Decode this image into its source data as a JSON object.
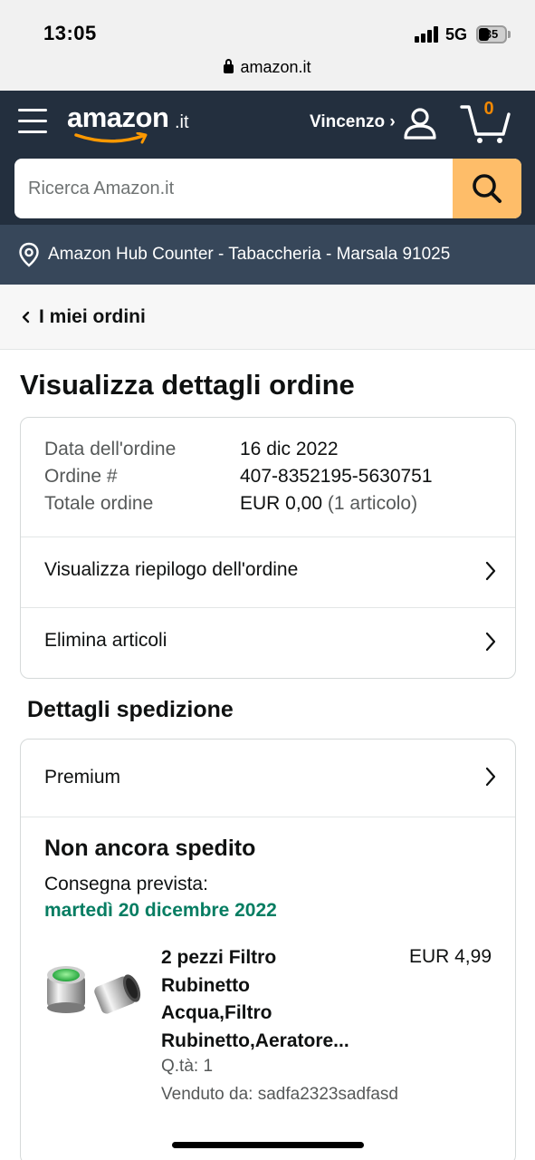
{
  "status_bar": {
    "time": "13:05",
    "network": "5G",
    "battery": "35",
    "url": "amazon.it"
  },
  "header": {
    "logo_word": "amazon",
    "logo_tld": ".it",
    "user_label": "Vincenzo ›",
    "cart_count": "0",
    "search_placeholder": "Ricerca Amazon.it",
    "location": "Amazon Hub Counter - Tabaccheria - Marsala 91025",
    "colors": {
      "nav_bg": "#232f3e",
      "location_bg": "#37475a",
      "search_button": "#febd69",
      "cart_count": "#f08804"
    }
  },
  "breadcrumb": {
    "label": "I miei ordini"
  },
  "page": {
    "title": "Visualizza dettagli ordine"
  },
  "order_info": {
    "date_label": "Data dell'ordine",
    "date_value": "16 dic 2022",
    "number_label": "Ordine #",
    "number_value": "407-8352195-5630751",
    "total_label": "Totale ordine",
    "total_value": "EUR 0,00",
    "total_items": "(1 articolo)"
  },
  "order_actions": {
    "summary": "Visualizza riepilogo dell'ordine",
    "delete": "Elimina articoli"
  },
  "shipping": {
    "section_title": "Dettagli spedizione",
    "method": "Premium",
    "status": "Non ancora spedito",
    "delivery_label": "Consegna prevista:",
    "delivery_date": "martedì 20 dicembre 2022",
    "delivery_color": "#067d62"
  },
  "product": {
    "title_lines": [
      "2 pezzi Filtro",
      "Rubinetto",
      "Acqua,Filtro",
      "Rubinetto,Aeratore..."
    ],
    "price": "EUR 4,99",
    "quantity": "Q.tà: 1",
    "seller": "Venduto da: sadfa2323sadfasd"
  }
}
